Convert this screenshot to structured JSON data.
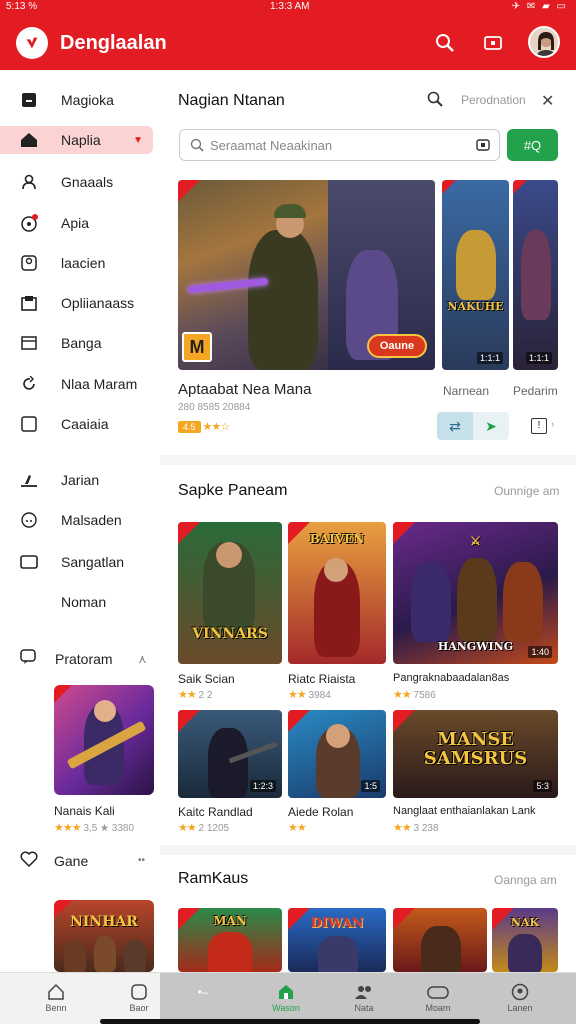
{
  "status": {
    "left": "5:13 %",
    "center": "1:3:3 AM",
    "right": "✈ ✉ ▰ ▭"
  },
  "app": {
    "title": "Denglaalan"
  },
  "sidebar": {
    "items": [
      {
        "label": "Magioka"
      },
      {
        "label": "Naplia"
      },
      {
        "label": "Gnaaals"
      },
      {
        "label": "Apia"
      },
      {
        "label": "laacien"
      },
      {
        "label": "Opliianaass"
      },
      {
        "label": "Banga"
      },
      {
        "label": "Nlaa Maram"
      },
      {
        "label": "Caaiaia"
      },
      {
        "label": "Jarian"
      },
      {
        "label": "Malsaden"
      },
      {
        "label": "Sangatlan"
      },
      {
        "label": "Noman"
      }
    ],
    "section1": {
      "label": "Pratoram",
      "card_name": "Nanais Kali",
      "card_meta": "3,5 ★ 3380"
    },
    "section2": {
      "label": "Gane",
      "card_title": "NINHAR"
    }
  },
  "featured": {
    "title": "Nagian Ntanan",
    "sub": "Perodnation",
    "search_placeholder": "Seraamat Neaakinan",
    "search_btn": "#Q",
    "main_title": "Aptaabat Nea Mana",
    "main_meta": "280 8585 20884",
    "main_rating": "4.5",
    "main_badge": "Oaune",
    "main_corner": "M",
    "side1_label": "Narnean",
    "side2_label": "Pedarim",
    "side1_art": "NAKUHE",
    "side1_num": "1:1:1",
    "side2_num": "1:1:1"
  },
  "section2": {
    "title": "Sapke Paneam",
    "sub": "Ounnige am",
    "cards": [
      {
        "name": "Saik Scian",
        "meta": "2 2",
        "art": "VINNARS"
      },
      {
        "name": "Riatc Riaista",
        "meta": "3984",
        "art": "BAIVEN"
      },
      {
        "name": "Pangraknabaadalan8as",
        "meta": "7586",
        "art": "HANGWING"
      },
      {
        "name": "Kaitc Randlad",
        "meta": "2 1205",
        "art": ""
      },
      {
        "name": "Aiede Rolan",
        "meta": "",
        "art": ""
      },
      {
        "name": "Nanglaat enthaianlakan Lank",
        "meta": "3 238",
        "art": "MANSE SAMSRUS"
      }
    ],
    "badges": [
      "",
      "",
      "1:40",
      "1:2:3",
      "1:5",
      "5:3"
    ]
  },
  "section3": {
    "title": "RamKaus",
    "sub": "Oannga am",
    "arts": [
      "MAN",
      "DIWAN",
      "",
      "NAK"
    ]
  },
  "bottomnav": [
    {
      "label": "Benn"
    },
    {
      "label": "Baor"
    },
    {
      "label": ""
    },
    {
      "label": "Wason"
    },
    {
      "label": "Nata"
    },
    {
      "label": "Moam"
    },
    {
      "label": "Lanen"
    }
  ],
  "colors": {
    "brand": "#e31b23",
    "accent": "#22a24a",
    "star": "#f5a623"
  }
}
